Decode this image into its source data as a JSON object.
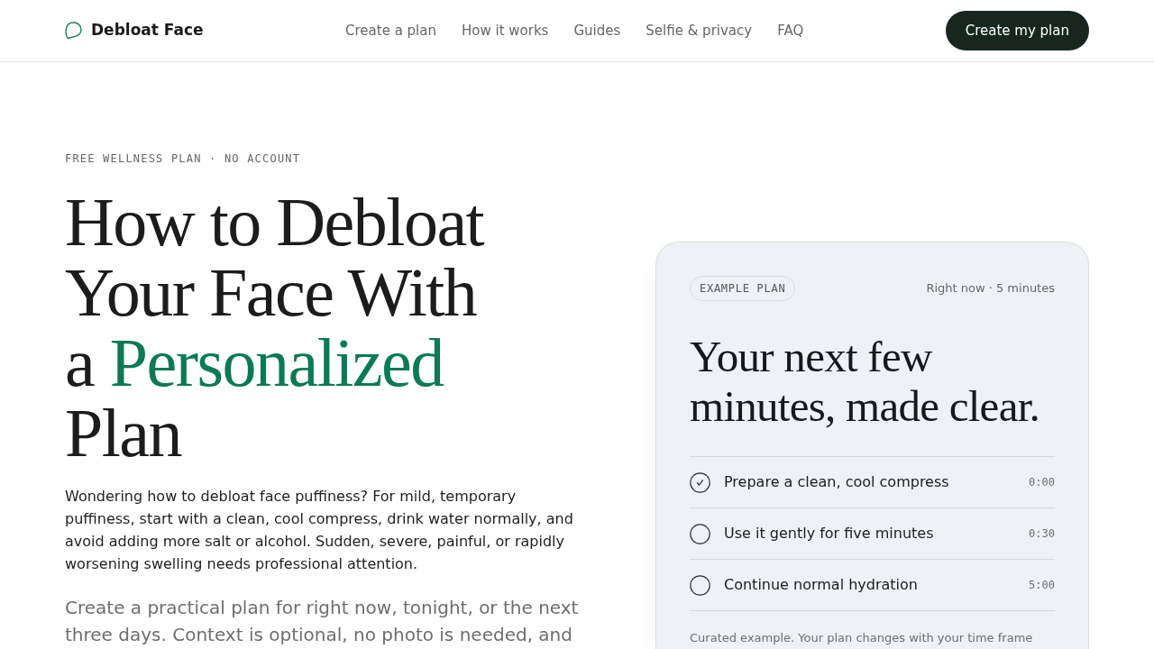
{
  "header": {
    "brand": "Debloat Face",
    "nav": [
      "Create a plan",
      "How it works",
      "Guides",
      "Selfie & privacy",
      "FAQ"
    ],
    "cta": "Create my plan"
  },
  "hero": {
    "eyebrow": "FREE WELLNESS PLAN · NO ACCOUNT",
    "title_parts": [
      {
        "text": "How to Debloat Your Face With a ",
        "highlight": false
      },
      {
        "text": "Personalized",
        "highlight": true
      },
      {
        "text": " Plan",
        "highlight": false
      }
    ],
    "intro": "Wondering how to debloat face puffiness? For mild, temporary puffiness, start with a clean, cool compress, drink water normally, and avoid adding more salt or alcohol. Sudden, severe, painful, or rapidly worsening swelling needs professional attention.",
    "lead": "Create a practical plan for right now, tonight, or the next three days. Context is optional, no photo is needed, and"
  },
  "example_card": {
    "badge": "EXAMPLE PLAN",
    "meta": "Right now · 5 minutes",
    "title": "Your next few minutes, made clear.",
    "steps": [
      {
        "label": "Prepare a clean, cool compress",
        "time": "0:00",
        "checked": true
      },
      {
        "label": "Use it gently for five minutes",
        "time": "0:30",
        "checked": false
      },
      {
        "label": "Continue normal hydration",
        "time": "5:00",
        "checked": false
      }
    ],
    "note": "Curated example. Your plan changes with your time frame"
  }
}
